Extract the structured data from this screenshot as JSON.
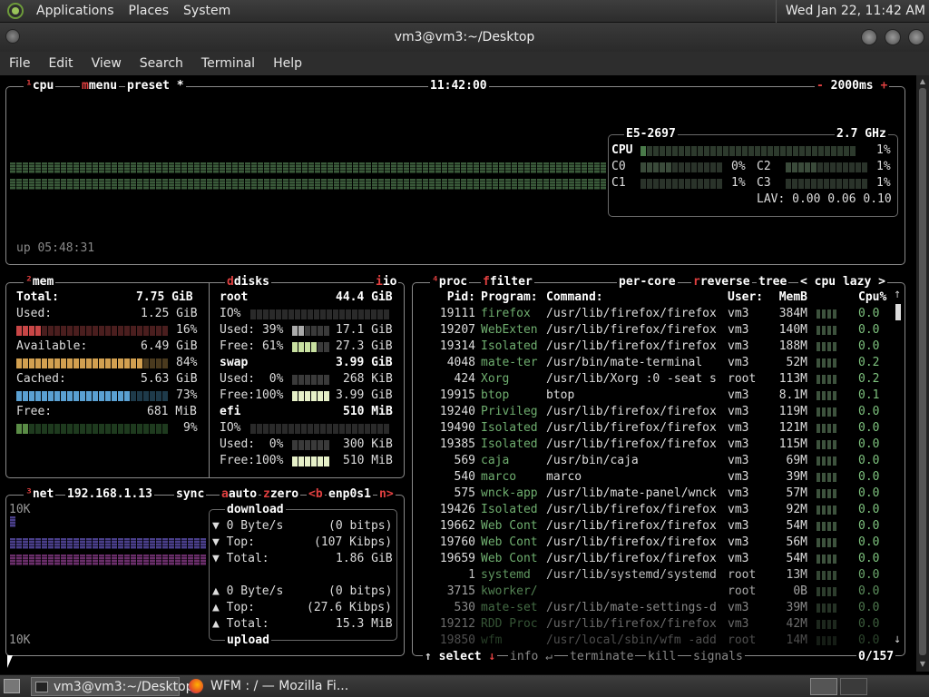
{
  "panel": {
    "menus": [
      "Applications",
      "Places",
      "System"
    ],
    "clock": "Wed Jan 22, 11:42 AM"
  },
  "window": {
    "title": "vm3@vm3:~/Desktop"
  },
  "menubar": [
    "File",
    "Edit",
    "View",
    "Search",
    "Terminal",
    "Help"
  ],
  "cpu": {
    "label": "cpu",
    "menu": "menu",
    "preset": "preset *",
    "time": "11:42:00",
    "interval": "2000ms",
    "model": "E5-2697",
    "freq": "2.7 GHz",
    "total": "1%",
    "c0": "0%",
    "c1": "1%",
    "c2": "1%",
    "c3": "1%",
    "lav": "LAV: 0.00 0.06 0.10",
    "uptime": "up 05:48:31",
    "total_label": "CPU",
    "c0_label": "C0",
    "c1_label": "C1",
    "c2_label": "C2",
    "c3_label": "C3"
  },
  "mem": {
    "label": "mem",
    "total_k": "Total:",
    "total": "7.75 GiB",
    "used_k": "Used:",
    "used": "1.25 GiB",
    "used_pct": "16%",
    "avail_k": "Available:",
    "avail": "6.49 GiB",
    "avail_pct": "84%",
    "cached_k": "Cached:",
    "cached": "5.63 GiB",
    "cached_pct": "73%",
    "free_k": "Free:",
    "free": "681 MiB",
    "free_pct": "9%"
  },
  "disks": {
    "label": "disks",
    "io": "io",
    "root": {
      "name": "root",
      "size": "44.4 GiB",
      "io": "IO%",
      "used": "Used: 39%",
      "used_v": "17.1 GiB",
      "free": "Free: 61%",
      "free_v": "27.3 GiB"
    },
    "swap": {
      "name": "swap",
      "size": "3.99 GiB",
      "used": "Used:  0%",
      "used_v": "268 KiB",
      "free": "Free:100%",
      "free_v": "3.99 GiB"
    },
    "efi": {
      "name": "efi",
      "size": "510 MiB",
      "io": "IO%",
      "used": "Used:  0%",
      "used_v": "300 KiB",
      "free": "Free:100%",
      "free_v": "510 MiB"
    }
  },
  "net": {
    "label": "net",
    "ip": "192.168.1.13",
    "sync": "sync",
    "auto": "auto",
    "zero": "zero",
    "prev": "<b",
    "iface": "enp0s1",
    "next": "n>",
    "scale_top": "10K",
    "scale_bottom": "10K",
    "download": "download",
    "upload": "upload",
    "dl_rate": "0 Byte/s",
    "dl_bitps": "(0 bitps)",
    "dl_top_k": "Top:",
    "dl_top": "(107 Kibps)",
    "dl_total_k": "Total:",
    "dl_total": "1.86 GiB",
    "ul_rate": "0 Byte/s",
    "ul_bitps": "(0 bitps)",
    "ul_top_k": "Top:",
    "ul_top": "(27.6 Kibps)",
    "ul_total_k": "Total:",
    "ul_total": "15.3 MiB"
  },
  "proc": {
    "label": "proc",
    "filter": "filter",
    "per_core": "per-core",
    "reverse": "reverse",
    "tree": "tree",
    "sort": "< cpu lazy >",
    "headers": {
      "pid": "Pid:",
      "program": "Program:",
      "command": "Command:",
      "user": "User:",
      "mem": "MemB",
      "cpu": "Cpu%"
    },
    "rows": [
      [
        "19111",
        "firefox",
        "/usr/lib/firefox/firefox",
        "vm3",
        "384M",
        "0.0"
      ],
      [
        "19207",
        "WebExten",
        "/usr/lib/firefox/firefox",
        "vm3",
        "140M",
        "0.0"
      ],
      [
        "19314",
        "Isolated",
        "/usr/lib/firefox/firefox",
        "vm3",
        "188M",
        "0.0"
      ],
      [
        "4048",
        "mate-ter",
        "/usr/bin/mate-terminal",
        "vm3",
        "52M",
        "0.2"
      ],
      [
        "424",
        "Xorg",
        "/usr/lib/Xorg :0 -seat s",
        "root",
        "113M",
        "0.2"
      ],
      [
        "19915",
        "btop",
        "btop",
        "vm3",
        "8.1M",
        "0.1"
      ],
      [
        "19240",
        "Privileg",
        "/usr/lib/firefox/firefox",
        "vm3",
        "119M",
        "0.0"
      ],
      [
        "19490",
        "Isolated",
        "/usr/lib/firefox/firefox",
        "vm3",
        "121M",
        "0.0"
      ],
      [
        "19385",
        "Isolated",
        "/usr/lib/firefox/firefox",
        "vm3",
        "115M",
        "0.0"
      ],
      [
        "569",
        "caja",
        "/usr/bin/caja",
        "vm3",
        "69M",
        "0.0"
      ],
      [
        "540",
        "marco",
        "marco",
        "vm3",
        "39M",
        "0.0"
      ],
      [
        "575",
        "wnck-app",
        "/usr/lib/mate-panel/wnck",
        "vm3",
        "57M",
        "0.0"
      ],
      [
        "19426",
        "Isolated",
        "/usr/lib/firefox/firefox",
        "vm3",
        "92M",
        "0.0"
      ],
      [
        "19662",
        "Web Cont",
        "/usr/lib/firefox/firefox",
        "vm3",
        "54M",
        "0.0"
      ],
      [
        "19760",
        "Web Cont",
        "/usr/lib/firefox/firefox",
        "vm3",
        "56M",
        "0.0"
      ],
      [
        "19659",
        "Web Cont",
        "/usr/lib/firefox/firefox",
        "vm3",
        "54M",
        "0.0"
      ],
      [
        "1",
        "systemd",
        "/usr/lib/systemd/systemd",
        "root",
        "13M",
        "0.0"
      ],
      [
        "3715",
        "kworker/",
        "",
        "root",
        "0B",
        "0.0"
      ],
      [
        "530",
        "mate-set",
        "/usr/lib/mate-settings-d",
        "vm3",
        "39M",
        "0.0"
      ],
      [
        "19212",
        "RDD Proc",
        "/usr/lib/firefox/firefox",
        "vm3",
        "42M",
        "0.0"
      ],
      [
        "19850",
        "wfm",
        "/usr/local/sbin/wfm -add",
        "root",
        "14M",
        "0.0"
      ]
    ],
    "select": "select",
    "info": "info",
    "terminate": "terminate",
    "kill": "kill",
    "signals": "signals",
    "count": "0/157"
  },
  "taskbar": {
    "task1": "vm3@vm3:~/Desktop",
    "task2": "WFM : / — Mozilla Fi..."
  },
  "colors": {
    "cpu_bar": "#3c6e3c",
    "mem_used": "#c84646",
    "mem_avail": "#d2a050",
    "mem_cached": "#5aa0d2",
    "mem_free": "#5a8c46",
    "net_dl": "#554a9c",
    "net_ul": "#7a3c7a",
    "label_red": "#e04040"
  }
}
